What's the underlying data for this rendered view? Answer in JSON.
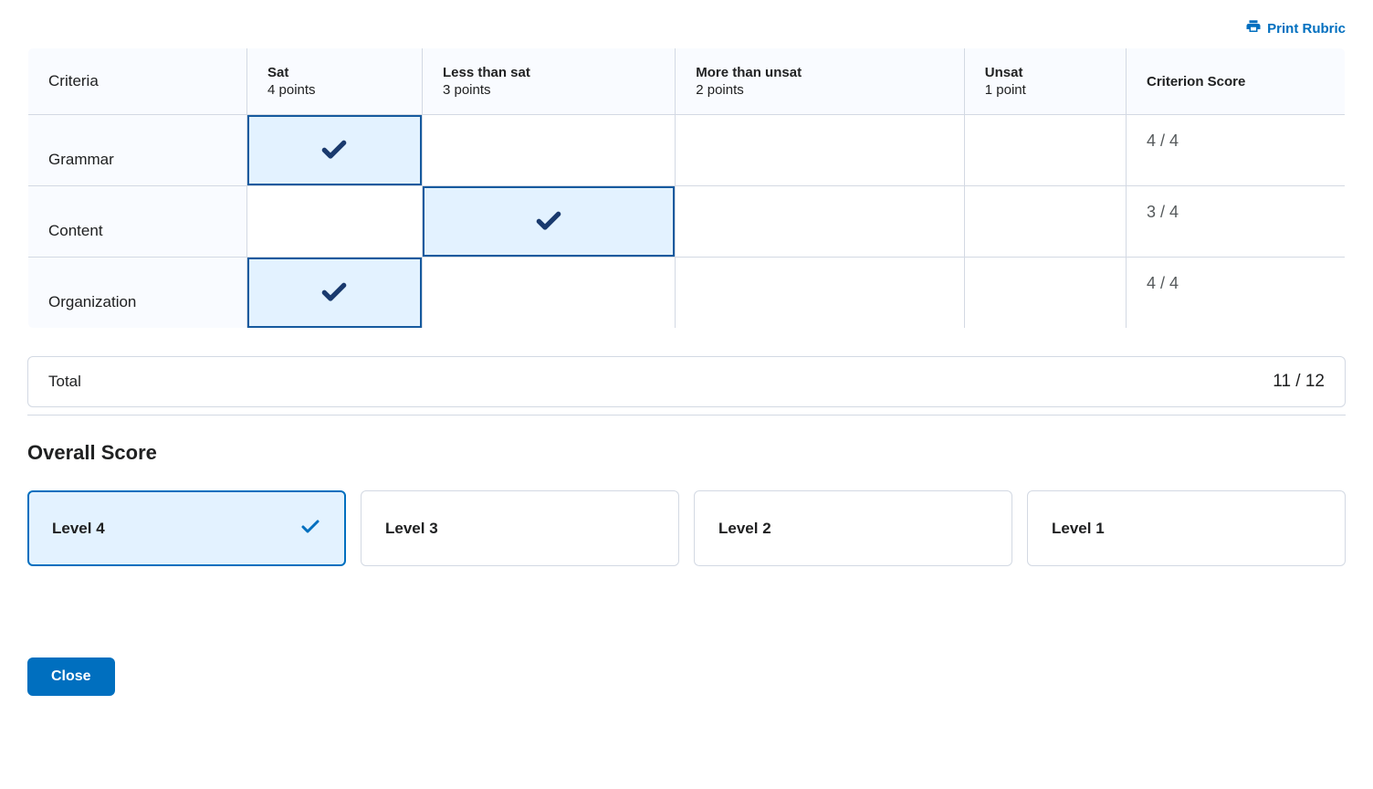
{
  "actions": {
    "print_label": "Print Rubric",
    "close_label": "Close"
  },
  "table": {
    "criteria_header": "Criteria",
    "score_header": "Criterion Score",
    "levels": [
      {
        "name": "Sat",
        "points": "4 points"
      },
      {
        "name": "Less than sat",
        "points": "3 points"
      },
      {
        "name": "More than unsat",
        "points": "2 points"
      },
      {
        "name": "Unsat",
        "points": "1 point"
      }
    ],
    "criteria": [
      {
        "name": "Grammar",
        "selected_index": 0,
        "score": "4 / 4"
      },
      {
        "name": "Content",
        "selected_index": 1,
        "score": "3 / 4"
      },
      {
        "name": "Organization",
        "selected_index": 0,
        "score": "4 / 4"
      }
    ]
  },
  "total": {
    "label": "Total",
    "value": "11 / 12"
  },
  "overall": {
    "title": "Overall Score",
    "levels": [
      {
        "label": "Level 4",
        "selected": true
      },
      {
        "label": "Level 3",
        "selected": false
      },
      {
        "label": "Level 2",
        "selected": false
      },
      {
        "label": "Level 1",
        "selected": false
      }
    ]
  }
}
